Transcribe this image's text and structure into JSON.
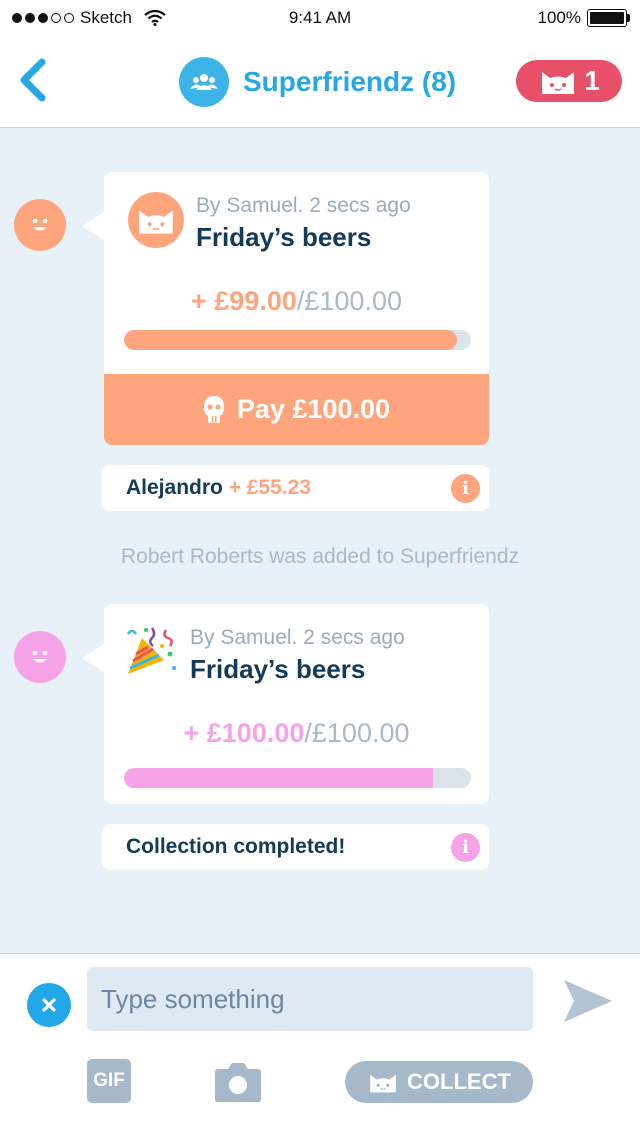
{
  "status_bar": {
    "carrier": "Sketch",
    "time": "9:41 AM",
    "battery": "100%"
  },
  "header": {
    "group_name": "Superfriendz (8)",
    "badge_count": "1",
    "back_icon": "chevron-left-icon",
    "group_icon": "group-icon"
  },
  "colors": {
    "accent": "#27a7e4",
    "badge": "#e8506a",
    "orange": "#ffa57e",
    "pink": "#f5a3e6",
    "navy": "#143a5a"
  },
  "messages": [
    {
      "meta": "By Samuel. 2 secs ago",
      "title": "Friday’s beers",
      "collected": "+ £99.00",
      "sep": "/",
      "target": "£100.00",
      "progress": 0.96,
      "pay_label": "Pay £100.00",
      "footer_name": "Alejandro",
      "footer_amount": "+ £55.23"
    },
    {
      "meta": "By Samuel. 2 secs ago",
      "title": "Friday’s beers",
      "collected": "+ £100.00",
      "sep": "/",
      "target": "£100.00",
      "progress": 0.89,
      "footer_text": "Collection completed!"
    }
  ],
  "system_message": "Robert Roberts was added to Superfriendz",
  "composer": {
    "placeholder": "Type something",
    "gif_label": "GIF",
    "collect_label": "COLLECT"
  }
}
